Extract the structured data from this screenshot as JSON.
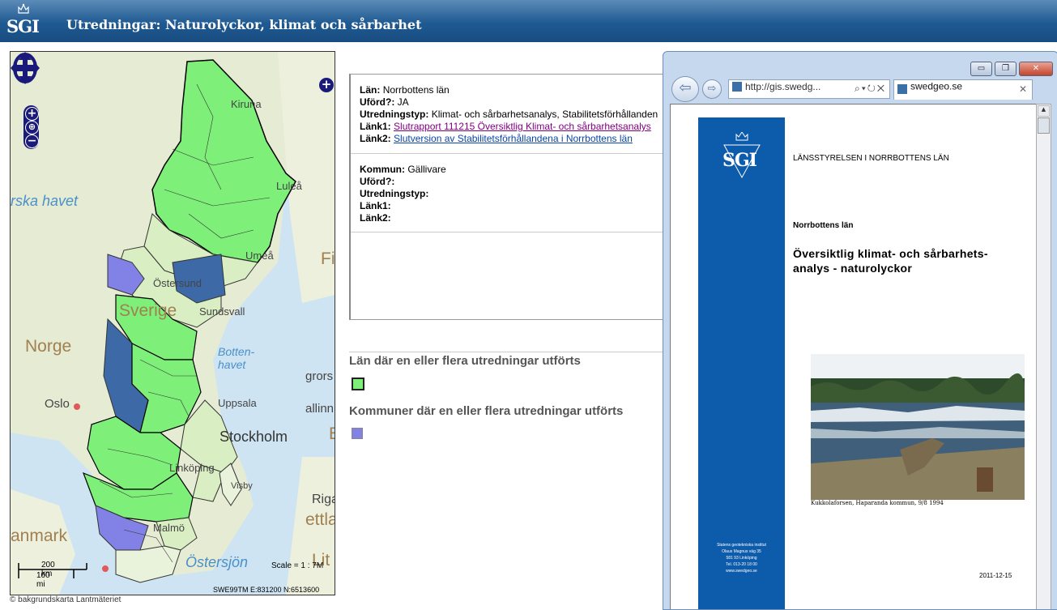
{
  "header": {
    "logo_text": "SGI",
    "title": "Utredningar: Naturolyckor, klimat och sårbarhet"
  },
  "map": {
    "labels": {
      "kiruna": "Kiruna",
      "lulea": "Luleå",
      "umea": "Umeå",
      "ostersund": "Östersund",
      "sundsvall": "Sundsvall",
      "sverige": "Sverige",
      "norge": "Norge",
      "oslo": "Oslo",
      "bottenhavet": "Botten-\nhavet",
      "norska_havet": "rska havet",
      "uppsala": "Uppsala",
      "stockholm": "Stockholm",
      "linkoping": "Linköping",
      "gotland": "Visby",
      "malmo": "Malmö",
      "riga": "Riga",
      "lettland": "ettla",
      "danmark": "anmark",
      "ostersjon": "Östersjön",
      "finland": "Fi",
      "alland": "allinn",
      "e_label": "E",
      "litauen": "Lit",
      "grors": "grors"
    },
    "scalebar": {
      "km": "200 km",
      "mi": "100 mi"
    },
    "scale_text": "Scale = 1 : 7M",
    "coords": "SWE99TM E:831200 N:6513600",
    "copyright": "© bakgrundskarta Lantmäteriet",
    "controls": {
      "zoom_in": "+",
      "zoom_out": "−",
      "layers": "+"
    }
  },
  "info": {
    "records": [
      {
        "lan_label": "Län:",
        "lan_value": "Norrbottens län",
        "uford_label": "Uförd?:",
        "uford_value": "JA",
        "typ_label": "Utredningstyp:",
        "typ_value": "Klimat- och sårbarhetsanalys, Stabilitetsförhållanden",
        "lank1_label": "Länk1:",
        "lank1_value": "Slutrapport 111215 Översiktlig Klimat- och sårbarhetsanalys",
        "lank2_label": "Länk2:",
        "lank2_value": "Slutversion av Stabilitetsförhållandena i Norrbottens län"
      },
      {
        "kommun_label": "Kommun:",
        "kommun_value": "Gällivare",
        "uford_label": "Uförd?:",
        "uford_value": "",
        "typ_label": "Utredningstyp:",
        "typ_value": "",
        "lank1_label": "Länk1:",
        "lank1_value": "",
        "lank2_label": "Länk2:",
        "lank2_value": ""
      }
    ]
  },
  "legend": {
    "lan_title": "Län där en eller flera utredningar utförts",
    "lan_color": "#7ef07a",
    "kommun_title": "Kommuner där en eller flera utredningar utförts",
    "kommun_color": "#8282e6"
  },
  "ie": {
    "controls": {
      "minimize": "▭",
      "restore": "❐",
      "close": "✕"
    },
    "address": "http://gis.swedg...",
    "tab_title": "swedgeo.se",
    "tab_close": "✕",
    "document": {
      "logo": "SGI",
      "authority": "LÄNSSTYRELSEN I NORRBOTTENS LÄN",
      "county": "Norrbottens län",
      "title_line1": "Översiktlig klimat- och sårbarhets-",
      "title_line2": "analys - naturolyckor",
      "photo_caption": "Kukkolaforsen, Haparanda kommun, 9/8 1994",
      "band_lines": [
        "Statens geotekniska institut",
        "Olaus Magnus väg 35",
        "581 93 Linköping",
        "Tel. 013-20 18 00",
        "www.swedgeo.se"
      ],
      "date": "2011-12-15"
    }
  }
}
